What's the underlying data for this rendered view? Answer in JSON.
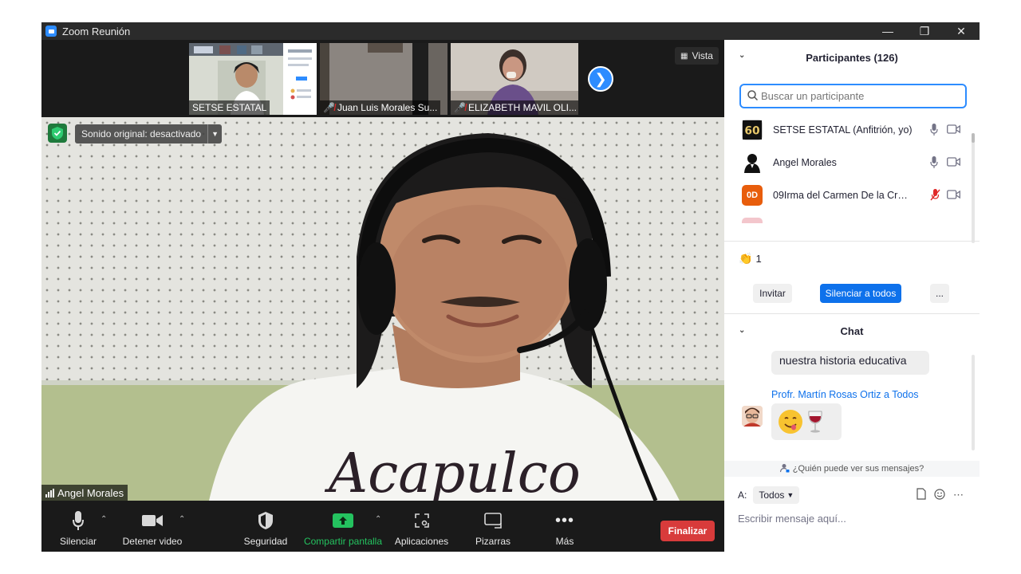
{
  "window": {
    "title": "Zoom Reunión",
    "minimize_icon": "minimize-icon",
    "restore_icon": "restore-icon",
    "close_icon": "close-icon"
  },
  "video": {
    "thumbnails": [
      {
        "name": "SETSE ESTATAL",
        "muted": false
      },
      {
        "name": "Juan Luis Morales Su...",
        "muted": true
      },
      {
        "name": "ELIZABETH MAVIL OLI...",
        "muted": true
      }
    ],
    "view_label": "Vista",
    "sound_label": "Sonido original: desactivado",
    "speaker_name": "Angel Morales",
    "shirt_text": "Acapulco"
  },
  "toolbar": {
    "mute_label": "Silenciar",
    "video_label": "Detener video",
    "security_label": "Seguridad",
    "share_label": "Compartir pantalla",
    "apps_label": "Aplicaciones",
    "whiteboards_label": "Pizarras",
    "more_label": "Más",
    "end_label": "Finalizar",
    "colors": {
      "share": "#24c25f",
      "end": "#d83b3b"
    }
  },
  "participants": {
    "header": "Participantes (126)",
    "search_placeholder": "Buscar un participante",
    "list": [
      {
        "name": "SETSE ESTATAL (Anfitrión, yo)",
        "avatar": "60",
        "mic_muted": false,
        "video_muted": false
      },
      {
        "name": "Angel Morales",
        "avatar": "silhouette",
        "mic_muted": false,
        "video_muted": false
      },
      {
        "name": "09Irma del Carmen De la Cruz ...",
        "avatar": "0D",
        "mic_muted": true,
        "video_muted": false
      }
    ],
    "reaction_count": "1",
    "invite_label": "Invitar",
    "mute_all_label": "Silenciar a todos",
    "more_label": "..."
  },
  "chat": {
    "header": "Chat",
    "message_1": "nuestra historia educativa",
    "sender": "Profr. Martín Rosas Ortiz a Todos",
    "who_can_see": "¿Quién puede ver sus mensajes?",
    "to_label": "A:",
    "to_value": "Todos",
    "input_placeholder": "Escribir mensaje aquí..."
  }
}
